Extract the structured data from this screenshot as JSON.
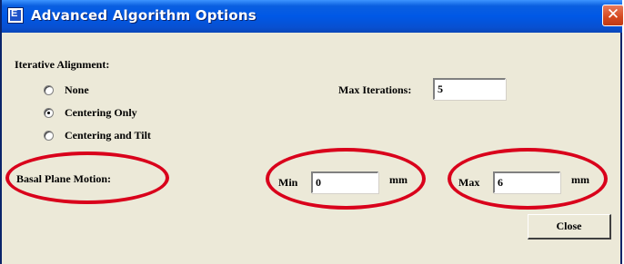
{
  "window": {
    "title": "Advanced Algorithm Options",
    "app_icon_glyph": "E",
    "close_glyph": "✕"
  },
  "iterative_alignment": {
    "heading": "Iterative Alignment:",
    "options": [
      {
        "label": "None",
        "checked": false
      },
      {
        "label": "Centering Only",
        "checked": true
      },
      {
        "label": "Centering and Tilt",
        "checked": false
      }
    ],
    "max_iterations_label": "Max Iterations:",
    "max_iterations_value": "5"
  },
  "basal_plane_motion": {
    "label": "Basal Plane Motion:",
    "min_label": "Min",
    "min_value": "0",
    "min_unit": "mm",
    "max_label": "Max",
    "max_value": "6",
    "max_unit": "mm"
  },
  "buttons": {
    "close_label": "Close"
  },
  "colors": {
    "annotation_ring": "#D9001B",
    "title_bar": "#0058E6",
    "dialog_background": "#ECE9D8"
  },
  "icons": [
    "app-icon",
    "close-icon",
    "radio-icon"
  ]
}
